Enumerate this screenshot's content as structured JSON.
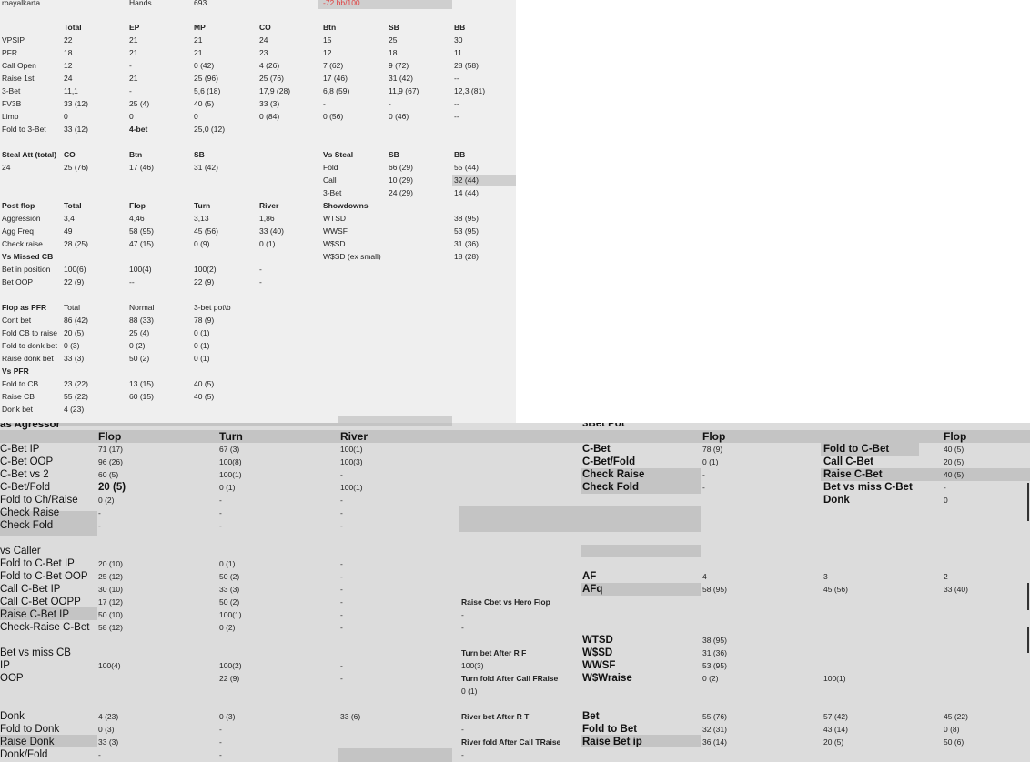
{
  "top": {
    "header": [
      {
        "text": "roayalkarta",
        "b": false
      },
      {
        "text": "Hands",
        "b": false
      },
      {
        "text": "693",
        "b": false
      },
      {
        "text": "-72 bb/100",
        "b": false,
        "red": true
      }
    ],
    "t1_head": [
      "Total",
      "EP",
      "MP",
      "CO",
      "Btn",
      "SB",
      "BB"
    ],
    "t1_rows": [
      [
        "VPSIP",
        "22",
        "21",
        "21",
        "24",
        "15",
        "25",
        "30"
      ],
      [
        "PFR",
        "18",
        "21",
        "21",
        "23",
        "12",
        "18",
        "11"
      ],
      [
        "Call Open",
        "12",
        "-",
        "0 (42)",
        "4 (26)",
        "7 (62)",
        "9 (72)",
        "28 (58)"
      ],
      [
        "Raise 1st",
        "24",
        "21",
        "25 (96)",
        "25 (76)",
        "17 (46)",
        "31 (42)",
        "--"
      ],
      [
        "3-Bet",
        "11,1",
        "-",
        "5,6 (18)",
        "17,9 (28)",
        "6,8 (59)",
        "11,9 (67)",
        "12,3 (81)"
      ],
      [
        "FV3B",
        "33 (12)",
        "25 (4)",
        "40 (5)",
        "33 (3)",
        "-",
        "-",
        "--"
      ],
      [
        "Limp",
        "0",
        "0",
        "0",
        "0 (84)",
        "0 (56)",
        "0 (46)",
        "--"
      ],
      [
        "Fold to 3-Bet",
        "33 (12)",
        "4-bet",
        "25,0 (12)",
        "",
        "",
        "",
        ""
      ]
    ],
    "steal_head": [
      "Steal Att (total)",
      "CO",
      "Btn",
      "SB"
    ],
    "steal_vals": [
      "24",
      "25 (76)",
      "17 (46)",
      "31 (42)"
    ],
    "vs_steal_head": [
      "Vs Steal",
      "SB",
      "BB"
    ],
    "vs_steal_rows": [
      [
        "Fold",
        "66 (29)",
        "55 (44)"
      ],
      [
        "Call",
        "10 (29)",
        "32 (44)"
      ],
      [
        "3-Bet",
        "24 (29)",
        "14 (44)"
      ]
    ],
    "post_head": [
      "Post flop",
      "Total",
      "Flop",
      "Turn",
      "River"
    ],
    "post_rows": [
      [
        "Aggression",
        "3,4",
        "4,46",
        "3,13",
        "1,86"
      ],
      [
        "Agg Freq",
        "49",
        "58 (95)",
        "45 (56)",
        "33 (40)"
      ],
      [
        "Check raise",
        "28 (25)",
        "47 (15)",
        "0 (9)",
        "0 (1)"
      ]
    ],
    "vs_missed_label": "Vs Missed CB",
    "vs_missed_rows": [
      [
        "Bet in position",
        "100(6)",
        "100(4)",
        "100(2)",
        "-"
      ],
      [
        "Bet OOP",
        "22 (9)",
        "--",
        "22 (9)",
        "-"
      ]
    ],
    "showdowns_label": "Showdowns",
    "showdown_rows": [
      [
        "WTSD",
        "38 (95)"
      ],
      [
        "WWSF",
        "53 (95)"
      ],
      [
        "W$SD",
        "31 (36)"
      ],
      [
        "W$SD (ex small)",
        "18 (28)"
      ]
    ],
    "pfr_head": [
      "Flop as PFR",
      "Total",
      "Normal",
      "3-bet pot\\b"
    ],
    "pfr_rows": [
      [
        "Cont bet",
        "86 (42)",
        "88 (33)",
        "78 (9)"
      ],
      [
        "Fold CB to raise",
        "20 (5)",
        "25 (4)",
        "0 (1)"
      ],
      [
        "Fold to donk bet",
        "0 (3)",
        "0 (2)",
        "0 (1)"
      ],
      [
        "Raise donk bet",
        "33 (3)",
        "50 (2)",
        "0 (1)"
      ]
    ],
    "vspfr_label": "Vs PFR",
    "vspfr_rows": [
      [
        "Fold to CB",
        "23 (22)",
        "13 (15)",
        "40 (5)"
      ],
      [
        "Raise CB",
        "55 (22)",
        "60 (15)",
        "40 (5)"
      ],
      [
        "Donk bet",
        "4 (23)",
        "",
        ""
      ]
    ]
  },
  "bottom": {
    "agg_title": "as Agressor",
    "agg_head": [
      "Flop",
      "Turn",
      "River"
    ],
    "agg_rows": [
      [
        "C-Bet IP",
        "71 (17)",
        "67 (3)",
        "100(1)"
      ],
      [
        "C-Bet OOP",
        "96 (26)",
        "100(8)",
        "100(3)"
      ],
      [
        "C-Bet vs 2",
        "60 (5)",
        "100(1)",
        "-"
      ],
      [
        "C-Bet/Fold",
        "20 (5)",
        "0 (1)",
        "100(1)"
      ],
      [
        "Fold to Ch/Raise",
        "0 (2)",
        "-",
        "-"
      ],
      [
        "Check Raise",
        "-",
        "-",
        "-"
      ],
      [
        "Check Fold",
        "-",
        "-",
        "-"
      ]
    ],
    "caller_title": "vs Caller",
    "caller_rows": [
      [
        "Fold to C-Bet IP",
        "20 (10)",
        "0 (1)",
        "-"
      ],
      [
        "Fold to C-Bet OOP",
        "25 (12)",
        "50 (2)",
        "-"
      ],
      [
        "Call C-Bet IP",
        "30 (10)",
        "33 (3)",
        "-"
      ],
      [
        "Call C-Bet OOPP",
        "17 (12)",
        "50 (2)",
        "-"
      ],
      [
        "Raise C-Bet IP",
        "50 (10)",
        "100(1)",
        "-"
      ],
      [
        "Check-Raise C-Bet",
        "58 (12)",
        "0 (2)",
        "-"
      ]
    ],
    "bvm_title": "Bet vs miss CB",
    "bvm_rows": [
      [
        "IP",
        "100(4)",
        "100(2)",
        "-"
      ],
      [
        "OOP",
        "",
        "22 (9)",
        "-"
      ]
    ],
    "donk_rows": [
      [
        "Donk",
        "4 (23)",
        "0 (3)",
        "33 (6)"
      ],
      [
        "Fold to Donk",
        "0 (3)",
        "-",
        ""
      ],
      [
        "Raise Donk",
        "33 (3)",
        "-",
        ""
      ],
      [
        "Donk/Fold",
        "-",
        "-",
        ""
      ]
    ],
    "threebet_title": "3Bet Pot",
    "tb_head_flop1": "Flop",
    "tb_head_flop2": "Flop",
    "tb_left": [
      [
        "C-Bet",
        "78 (9)"
      ],
      [
        "C-Bet/Fold",
        "0 (1)"
      ],
      [
        "Check Raise",
        "-"
      ],
      [
        "Check Fold",
        "-"
      ]
    ],
    "tb_right": [
      [
        "Fold to C-Bet",
        "40 (5)"
      ],
      [
        "Call C-Bet",
        "20 (5)"
      ],
      [
        "Raise C-Bet",
        "40 (5)"
      ],
      [
        "Bet vs miss C-Bet",
        "-"
      ],
      [
        "Donk",
        "0"
      ]
    ],
    "af_rows": [
      [
        "AF",
        "4",
        "3",
        "2"
      ],
      [
        "AFq",
        "58 (95)",
        "45 (56)",
        "33 (40)"
      ]
    ],
    "hero": [
      "Raise Cbet vs Hero Flop",
      "-",
      "-",
      "Turn bet After R F",
      "100(3)",
      "Turn fold After Call FRaise",
      "0 (1)",
      "River bet After R T",
      "-",
      "River fold After Call TRaise",
      "-"
    ],
    "sd_rows": [
      [
        "WTSD",
        "38 (95)"
      ],
      [
        "W$SD",
        "31 (36)"
      ],
      [
        "WWSF",
        "53 (95)"
      ],
      [
        "W$Wraise",
        "0 (2)",
        "100(1)"
      ]
    ],
    "bet_rows": [
      [
        "Bet",
        "55 (76)",
        "57 (42)",
        "45 (22)"
      ],
      [
        "Fold to Bet",
        "32 (31)",
        "43 (14)",
        "0 (8)"
      ],
      [
        "Raise Bet ip",
        "36 (14)",
        "20 (5)",
        "50 (6)"
      ]
    ]
  }
}
